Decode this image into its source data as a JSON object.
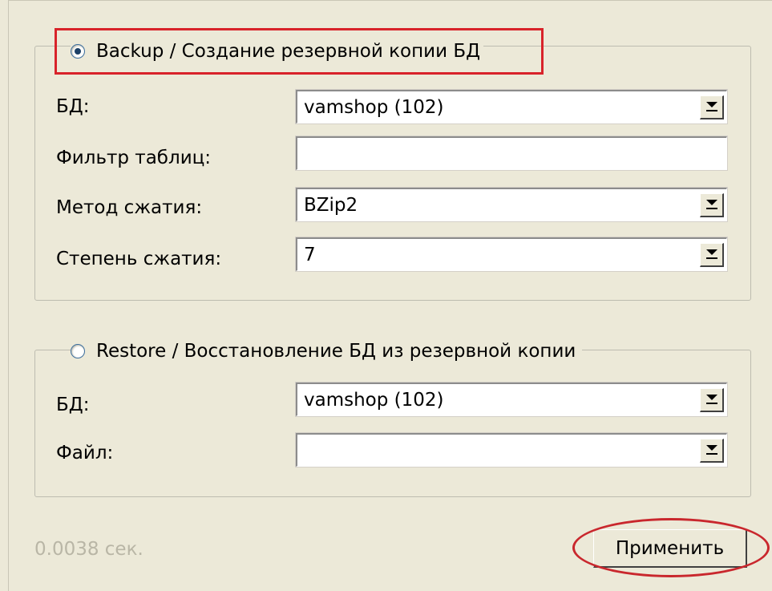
{
  "backup": {
    "title": "Backup / Создание резервной копии БД",
    "selected": true,
    "db_label": "БД:",
    "db_value": "vamshop (102)",
    "filter_label": "Фильтр таблиц:",
    "filter_value": "",
    "method_label": "Метод сжатия:",
    "method_value": "BZip2",
    "level_label": "Степень сжатия:",
    "level_value": "7"
  },
  "restore": {
    "title": "Restore / Восстановление БД из резервной копии",
    "selected": false,
    "db_label": "БД:",
    "db_value": "vamshop (102)",
    "file_label": "Файл:",
    "file_value": ""
  },
  "footer": {
    "timing": "0.0038 сек.",
    "apply_label": "Применить"
  },
  "colors": {
    "highlight": "#d8232a",
    "window_bg": "#ece9d8"
  },
  "icons": {
    "radio_checked": "radio-checked-icon",
    "radio_unchecked": "radio-unchecked-icon",
    "dropdown": "chevron-down-icon"
  }
}
